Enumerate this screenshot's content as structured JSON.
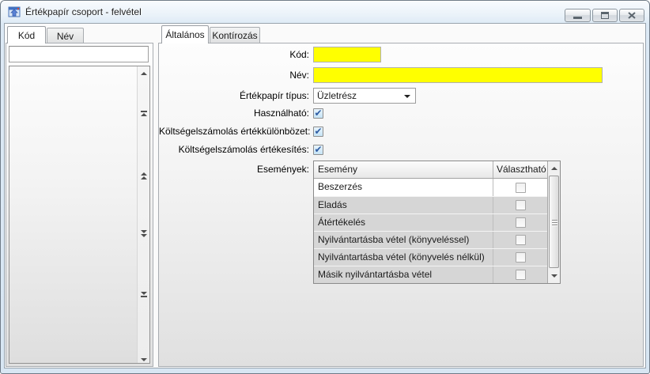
{
  "window": {
    "title": "Értékpapír csoport - felvétel"
  },
  "glyphs": {
    "check": "✔"
  },
  "colors": {
    "highlight_field": "#ffff00",
    "frame": "#d8e6f3",
    "row_gray": "#d6d6d6"
  },
  "left_panel": {
    "tabs": [
      {
        "label": "Kód",
        "active": true
      },
      {
        "label": "Név",
        "active": false
      }
    ],
    "filter_value": "",
    "list_items": []
  },
  "right_panel": {
    "tabs": [
      {
        "label": "Általános",
        "active": true
      },
      {
        "label": "Kontírozás",
        "active": false
      }
    ],
    "form": {
      "kod_label": "Kód:",
      "kod_value": "",
      "nev_label": "Név:",
      "nev_value": "",
      "tipus_label": "Értékpapír típus:",
      "tipus_value": "Üzletrész",
      "hasznalhato_label": "Használható:",
      "hasznalhato_checked": true,
      "ertekkulonbozet_label": "Költségelszámolás értékkülönbözet:",
      "ertekkulonbozet_checked": true,
      "ertekesites_label": "Költségelszámolás értékesítés:",
      "ertekesites_checked": true,
      "esemenyek_label": "Események:"
    },
    "events_table": {
      "columns": [
        "Esemény",
        "Választható"
      ],
      "rows": [
        {
          "esemeny": "Beszerzés",
          "valaszthato": false
        },
        {
          "esemeny": "Eladás",
          "valaszthato": false
        },
        {
          "esemeny": "Átértékelés",
          "valaszthato": false
        },
        {
          "esemeny": "Nyilvántartásba vétel (könyveléssel)",
          "valaszthato": false
        },
        {
          "esemeny": "Nyilvántartásba vétel (könyvelés nélkül)",
          "valaszthato": false
        },
        {
          "esemeny": "Másik nyilvántartásba vétel",
          "valaszthato": false
        }
      ]
    }
  }
}
